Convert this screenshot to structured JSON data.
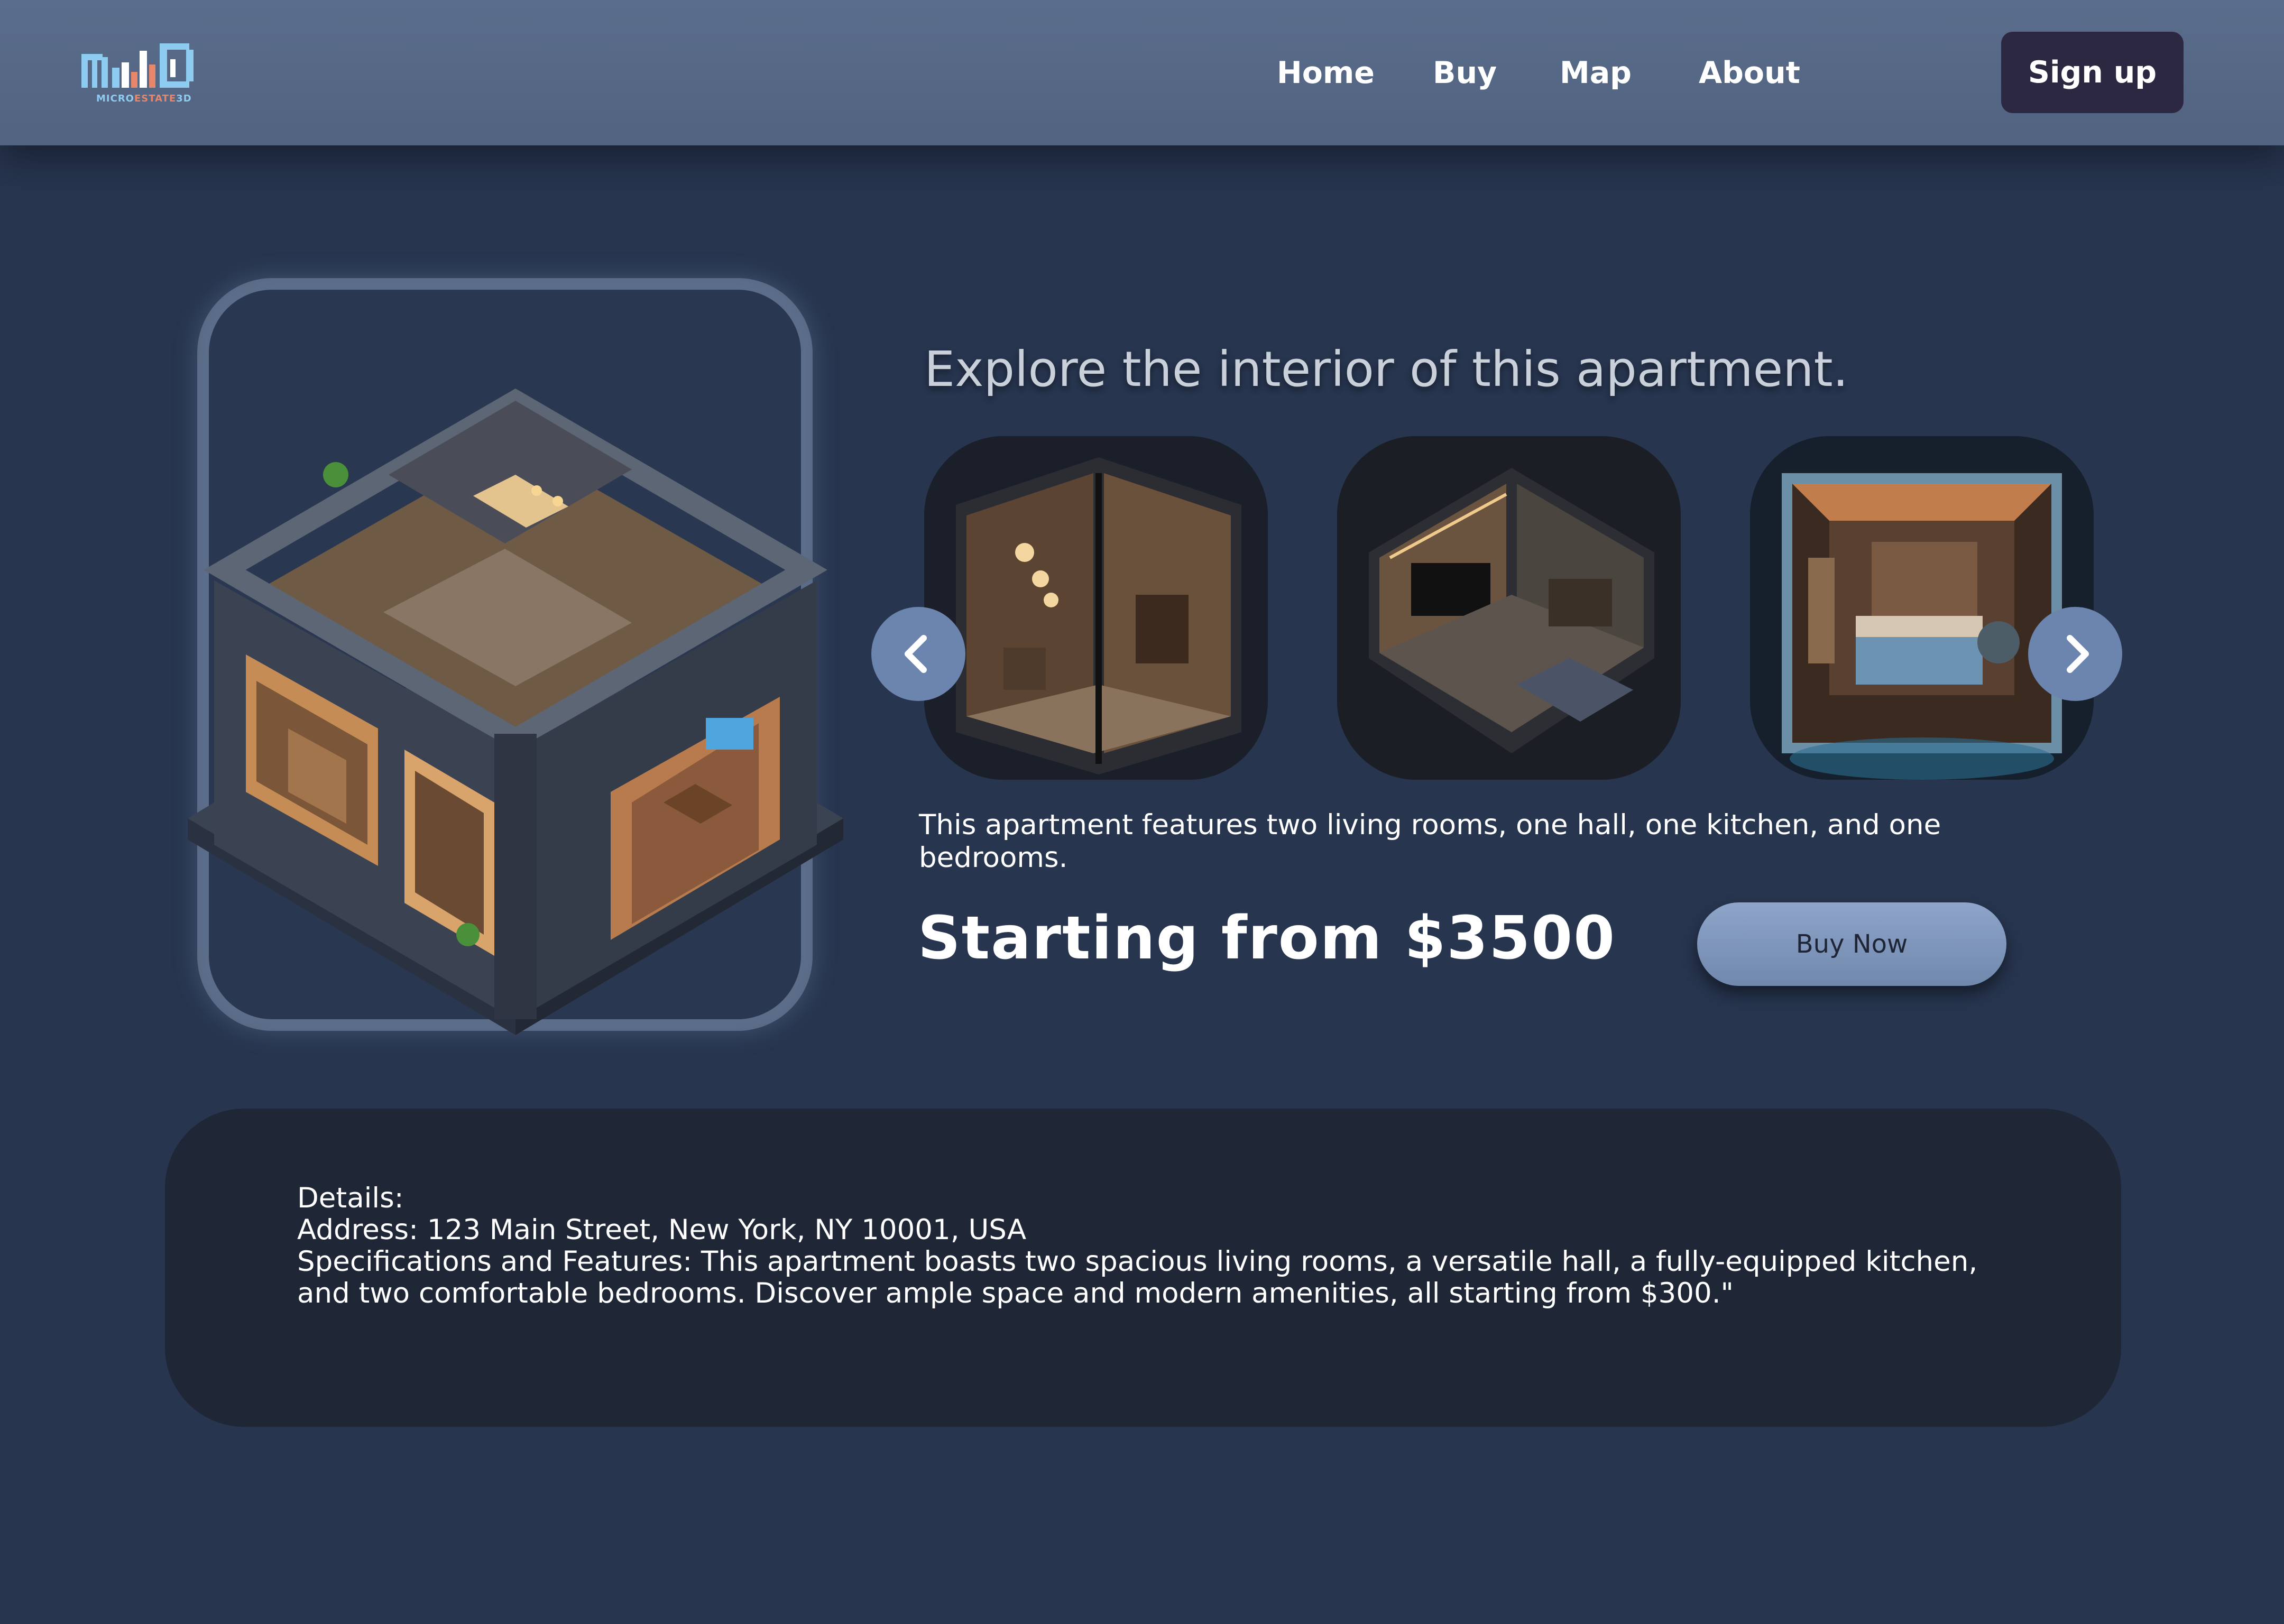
{
  "header": {
    "logo": {
      "caption_part1": "MICRO",
      "caption_part2": "ESTATE",
      "caption_part3": "3D",
      "icon": "building-logo-icon"
    },
    "nav": [
      {
        "label": "Home"
      },
      {
        "label": "Buy"
      },
      {
        "label": "Map"
      },
      {
        "label": "About"
      }
    ],
    "signup_label": "Sign up"
  },
  "hero": {
    "title": "Explore the interior of this apartment.",
    "main_image": "isometric-apartment-image",
    "thumbnails": [
      {
        "name": "living-room-thumbnail"
      },
      {
        "name": "tv-lounge-thumbnail"
      },
      {
        "name": "bedroom-thumbnail"
      }
    ],
    "prev_icon": "chevron-left-icon",
    "next_icon": "chevron-right-icon",
    "description": "This apartment features two living rooms, one hall, one kitchen, and one bedrooms.",
    "price": "Starting from $3500",
    "buy_label": "Buy Now"
  },
  "details": {
    "line1": "Details:",
    "line2": "Address: 123 Main Street, New York, NY 10001, USA",
    "line3": "Specifications and Features: This apartment boasts two spacious living rooms, a versatile hall, a fully-equipped kitchen, and two comfortable bedrooms. Discover ample space and modern amenities, all starting from $300.\""
  },
  "colors": {
    "background": "#27354f",
    "header": "#55677f",
    "signup": "#2d2842",
    "carousel_button": "#6c85ae",
    "details_panel": "#1f2737",
    "buy_button": "#8096bc"
  }
}
